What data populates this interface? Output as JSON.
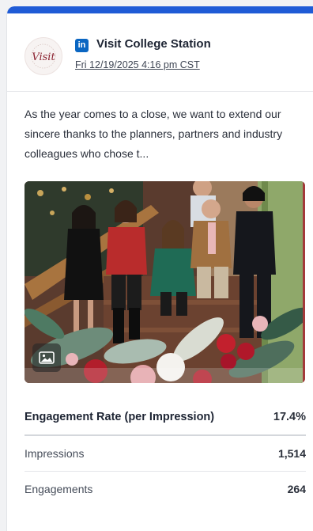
{
  "post": {
    "network_icon": "linkedin-icon",
    "network_glyph": "in",
    "account_name": "Visit College Station",
    "avatar_logo_text": "Visit",
    "timestamp": "Fri 12/19/2025 4:16 pm CST",
    "text": "As the year comes to a close, we want to extend our sincere thanks to the planners, partners and industry colleagues who chose t...",
    "media_icon": "image-icon"
  },
  "metrics": {
    "primary": {
      "label": "Engagement Rate (per Impression)",
      "value": "17.4%"
    },
    "rows": [
      {
        "label": "Impressions",
        "value": "1,514"
      },
      {
        "label": "Engagements",
        "value": "264"
      }
    ]
  },
  "colors": {
    "accent_bar": "#1f5bd6",
    "linkedin": "#0a66c2",
    "logo": "#8b2230"
  }
}
